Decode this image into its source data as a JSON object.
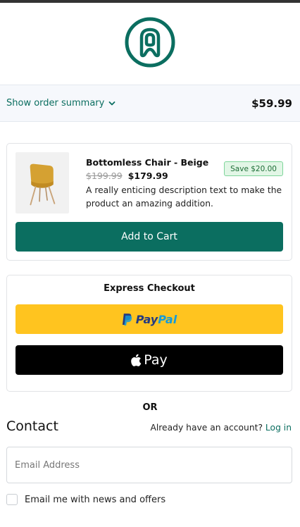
{
  "header": {
    "logo_icon": "brand-logo-a-icon",
    "brand_color": "#0b6e60"
  },
  "summary": {
    "toggle_label": "Show order summary",
    "total": "$59.99"
  },
  "product": {
    "image_icon": "chair-image",
    "title": "Bottomless Chair - Beige",
    "price_old": "$199.99",
    "price_new": "$179.99",
    "save_badge": "Save $20.00",
    "description": "A really enticing description text to make the product an amazing addition.",
    "add_to_cart": "Add to Cart"
  },
  "express": {
    "title": "Express Checkout",
    "paypal_part1": "Pay",
    "paypal_part2": "Pal",
    "applepay_label": "Pay"
  },
  "or_label": "OR",
  "contact": {
    "title": "Contact",
    "account_prompt": "Already have an account?",
    "login_link": "Log in",
    "email_placeholder": "Email Address",
    "newsletter_label": "Email me with news and offers"
  }
}
